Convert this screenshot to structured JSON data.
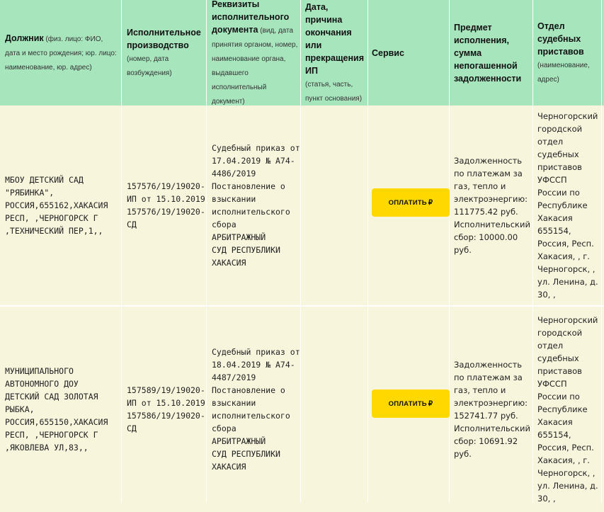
{
  "table": {
    "headers": [
      {
        "main": "Должник",
        "sub": " (физ. лицо: ФИО, дата и место рождения; юр. лицо: наименование, юр. адрес)"
      },
      {
        "main": "Исполнительное производство",
        "sub": "(номер, дата возбуждения)"
      },
      {
        "main": "Реквизиты исполнительного документа",
        "sub": " (вид, дата принятия органом, номер, наименование органа, выдавшего исполнительный документ)"
      },
      {
        "main": "Дата, причина окончания или прекращения ИП",
        "sub": " (статья, часть, пункт основания)"
      },
      {
        "main": "Сервис",
        "sub": ""
      },
      {
        "main": "Предмет исполнения, сумма непогашенной задолженности",
        "sub": ""
      },
      {
        "main": "Отдел судебных приставов",
        "sub": " (наименование, адрес)"
      }
    ],
    "rows": [
      {
        "debtor": "МБОУ ДЕТСКИЙ САД\n\"РЯБИНКА\",\nРОССИЯ,655162,ХАКАСИЯ\nРЕСП, ,ЧЕРНОГОРСК Г\n,ТЕХНИЧЕСКИЙ ПЕР,1,,",
        "proceeding": "157576/19/19020-\nИП от 15.10.2019\n157576/19/19020-\nСД",
        "document": "Судебный приказ от\n17.04.2019 № А74-\n4486/2019\nПостановление о\nвзыскании\nисполнительского\nсбора\nАРБИТРАЖНЫЙ\nСУД РЕСПУБЛИКИ\nХАКАСИЯ",
        "end_reason": "",
        "service_label": "ОПЛАТИТЬ",
        "subject": "Задолженность\nпо платежам за\nгаз, тепло и\nэлектроэнергию:\n111775.42 руб.\nИсполнительский\nсбор: 10000.00\nруб.",
        "department": "Черногорский\nгородской\nотдел\nсудебных\nприставов\nУФССП\nРоссии по\nРеспублике\nХакасия\n655154,\nРоссия, Респ.\nХакасия, , г.\nЧерногорск, ,\nул. Ленина, д.\n30, ,"
      },
      {
        "debtor": "МУНИЦИПАЛЬНОГО\nАВТОНОМНОГО ДОУ\nДЕТСКИЙ САД ЗОЛОТАЯ\nРЫБКА,\nРОССИЯ,655150,ХАКАСИЯ\nРЕСП, ,ЧЕРНОГОРСК Г\n,ЯКОВЛЕВА УЛ,83,,",
        "proceeding": "157589/19/19020-\nИП от 15.10.2019\n157586/19/19020-\nСД",
        "document": "Судебный приказ от\n18.04.2019 № А74-\n4487/2019\nПостановление о\nвзыскании\nисполнительского\nсбора\nАРБИТРАЖНЫЙ\nСУД РЕСПУБЛИКИ\nХАКАСИЯ",
        "end_reason": "",
        "service_label": "ОПЛАТИТЬ",
        "subject": "Задолженность\nпо платежам за\nгаз, тепло и\nэлектроэнергию:\n152741.77 руб.\nИсполнительский\nсбор: 10691.92\nруб.",
        "department": "Черногорский\nгородской\nотдел\nсудебных\nприставов\nУФССП\nРоссии по\nРеспублике\nХакасия\n655154,\nРоссия, Респ.\nХакасия, , г.\nЧерногорск, ,\nул. Ленина, д.\n30, ,"
      }
    ]
  },
  "icons": {
    "ruble": "₽"
  },
  "colors": {
    "header_bg": "#a7e5bd",
    "row_bg": "#f8f5dd",
    "button_bg": "#ffd800"
  }
}
